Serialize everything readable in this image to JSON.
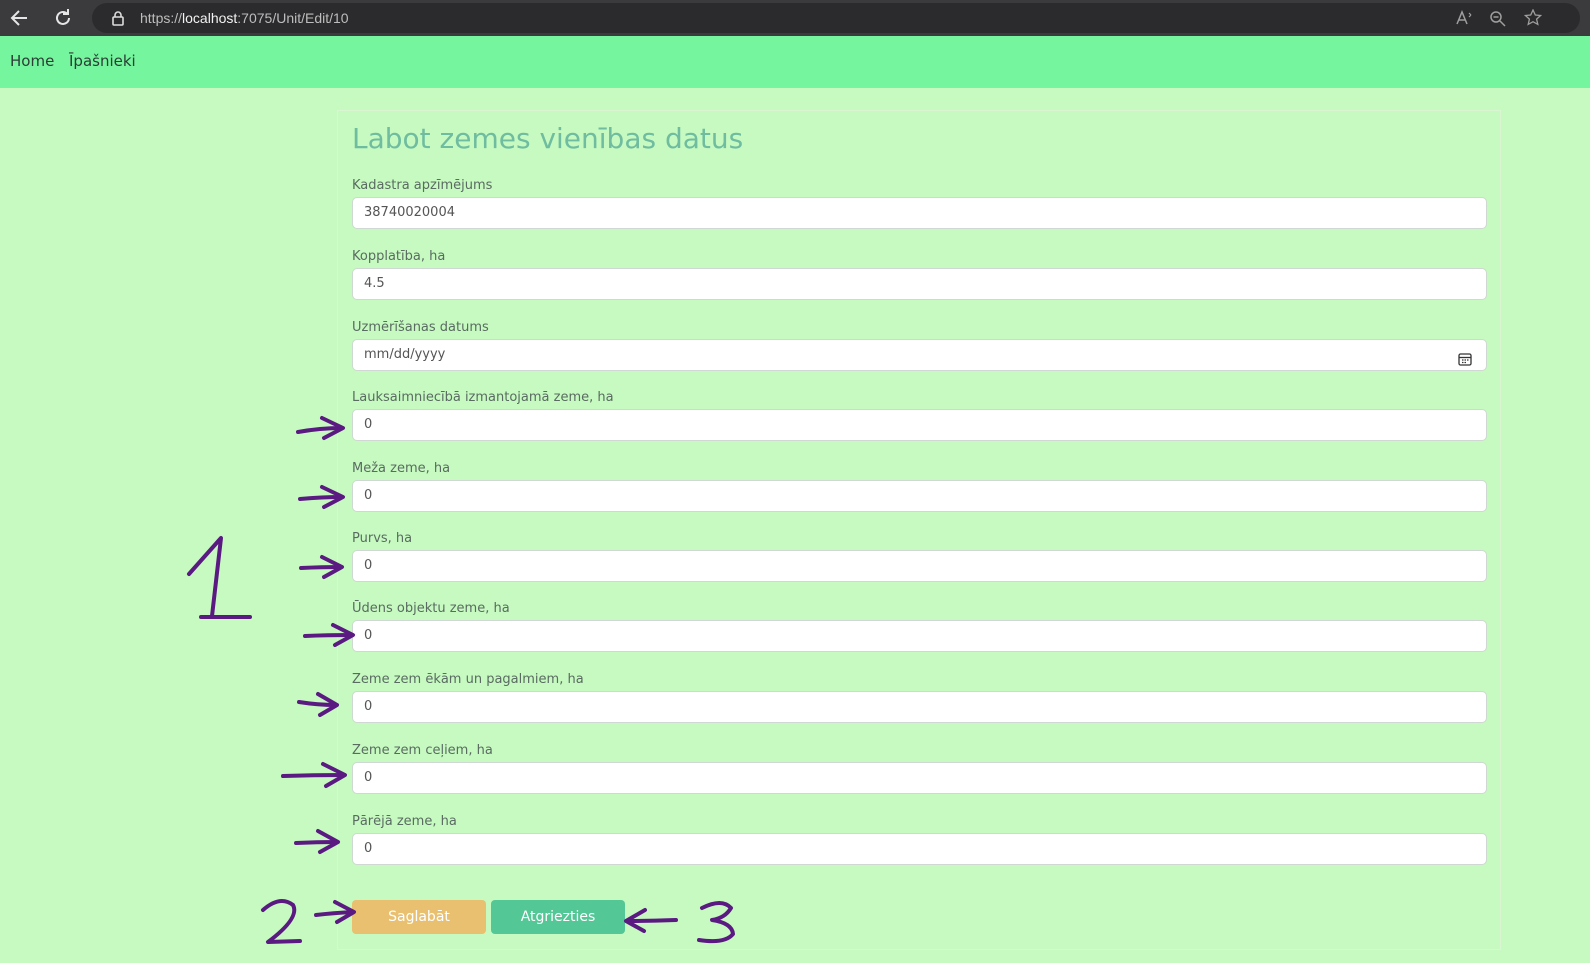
{
  "browser": {
    "url_prefix": "https://",
    "url_host": "localhost",
    "url_path": ":7075/Unit/Edit/10"
  },
  "nav": {
    "home": "Home",
    "owners": "Īpašnieki"
  },
  "form": {
    "title": "Labot zemes vienības datus",
    "fields": [
      {
        "label": "Kadastra apzīmējums",
        "value": "38740020004"
      },
      {
        "label": "Kopplatība, ha",
        "value": "4.5"
      },
      {
        "label": "Uzmērīšanas datums",
        "placeholder": "mm/dd/yyyy"
      },
      {
        "label": "Lauksaimniecībā izmantojamā zeme, ha",
        "value": "0"
      },
      {
        "label": "Meža zeme, ha",
        "value": "0"
      },
      {
        "label": "Purvs, ha",
        "value": "0"
      },
      {
        "label": "Ūdens objektu zeme, ha",
        "value": "0"
      },
      {
        "label": "Zeme zem ēkām un pagalmiem, ha",
        "value": "0"
      },
      {
        "label": "Zeme zem ceļiem, ha",
        "value": "0"
      },
      {
        "label": "Pārējā zeme, ha",
        "value": "0"
      }
    ],
    "save_label": "Saglabāt",
    "back_label": "Atgriezties"
  },
  "annotations": {
    "marker_1": "1",
    "marker_2": "2",
    "marker_3": "3",
    "ink_color": "#5a1a82"
  }
}
